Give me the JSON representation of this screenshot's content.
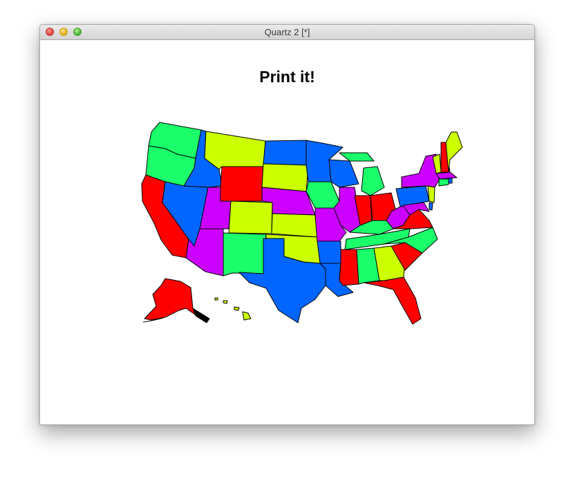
{
  "window": {
    "title": "Quartz 2 [*]"
  },
  "plot": {
    "title": "Print it!"
  },
  "palette": {
    "red": "#ff0000",
    "blue": "#0066ff",
    "green": "#1aff6a",
    "yellow": "#ccff00",
    "purple": "#cc00ff"
  }
}
